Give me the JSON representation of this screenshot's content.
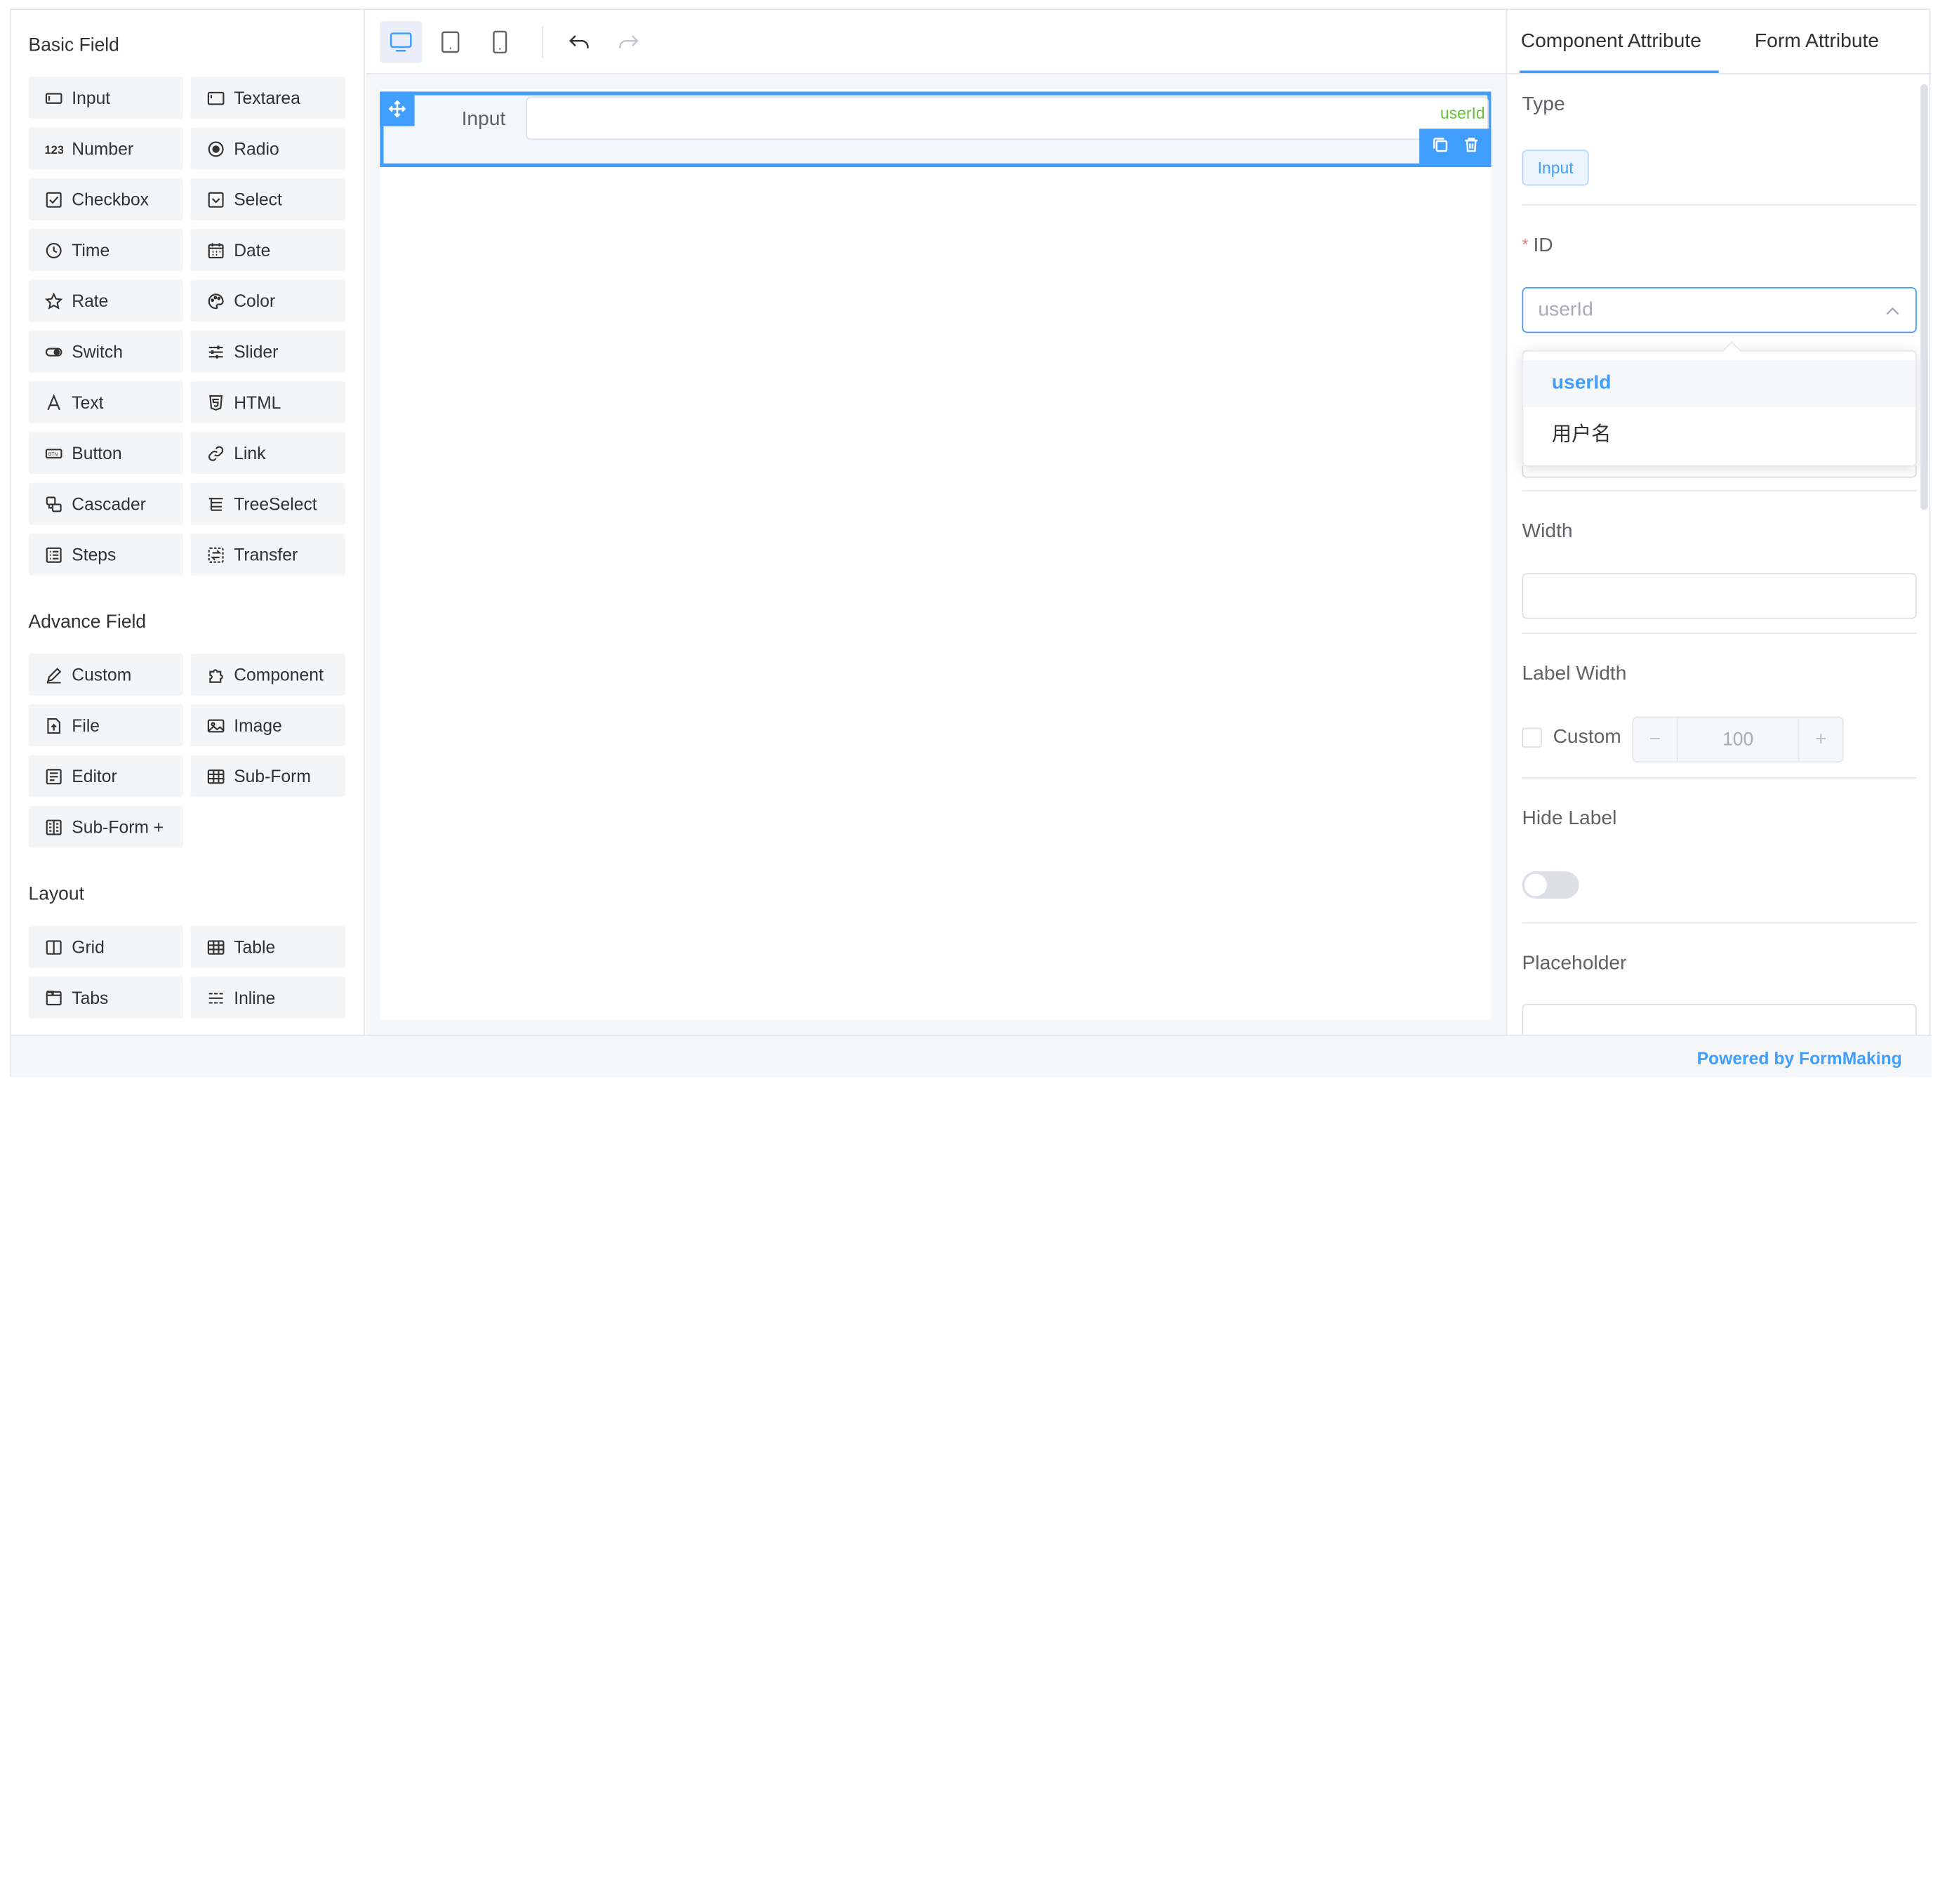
{
  "left_panel": {
    "sections": [
      {
        "title": "Basic Field",
        "items": [
          {
            "label": "Input",
            "icon": "input-icon"
          },
          {
            "label": "Textarea",
            "icon": "textarea-icon"
          },
          {
            "label": "Number",
            "icon": "number-icon"
          },
          {
            "label": "Radio",
            "icon": "radio-icon"
          },
          {
            "label": "Checkbox",
            "icon": "checkbox-icon"
          },
          {
            "label": "Select",
            "icon": "select-icon"
          },
          {
            "label": "Time",
            "icon": "clock-icon"
          },
          {
            "label": "Date",
            "icon": "calendar-icon"
          },
          {
            "label": "Rate",
            "icon": "star-icon"
          },
          {
            "label": "Color",
            "icon": "palette-icon"
          },
          {
            "label": "Switch",
            "icon": "switch-icon"
          },
          {
            "label": "Slider",
            "icon": "slider-icon"
          },
          {
            "label": "Text",
            "icon": "text-icon"
          },
          {
            "label": "HTML",
            "icon": "html-icon"
          },
          {
            "label": "Button",
            "icon": "button-icon"
          },
          {
            "label": "Link",
            "icon": "link-icon"
          },
          {
            "label": "Cascader",
            "icon": "cascader-icon"
          },
          {
            "label": "TreeSelect",
            "icon": "tree-icon"
          },
          {
            "label": "Steps",
            "icon": "steps-icon"
          },
          {
            "label": "Transfer",
            "icon": "transfer-icon"
          }
        ]
      },
      {
        "title": "Advance Field",
        "items": [
          {
            "label": "Custom",
            "icon": "pen-icon"
          },
          {
            "label": "Component",
            "icon": "puzzle-icon"
          },
          {
            "label": "File",
            "icon": "file-upload-icon"
          },
          {
            "label": "Image",
            "icon": "image-icon"
          },
          {
            "label": "Editor",
            "icon": "editor-icon"
          },
          {
            "label": "Sub-Form",
            "icon": "table-icon"
          },
          {
            "label": "Sub-Form +",
            "icon": "subform-plus-icon"
          }
        ]
      },
      {
        "title": "Layout",
        "items": [
          {
            "label": "Grid",
            "icon": "grid-icon"
          },
          {
            "label": "Table",
            "icon": "table-icon"
          },
          {
            "label": "Tabs",
            "icon": "tabs-icon"
          },
          {
            "label": "Inline",
            "icon": "inline-icon"
          }
        ]
      }
    ]
  },
  "toolbar": {
    "buttons": [
      "desktop-icon",
      "tablet-icon",
      "mobile-icon",
      "undo-icon",
      "redo-icon"
    ],
    "active": "desktop-icon"
  },
  "canvas": {
    "field": {
      "label": "Input",
      "model": "userId"
    }
  },
  "right_panel": {
    "tabs": [
      "Component Attribute",
      "Form Attribute"
    ],
    "active_tab": "Component Attribute",
    "type_label": "Type",
    "type_value": "Input",
    "id_required_mark": "*",
    "id_label": "ID",
    "id_value": "userId",
    "id_options": [
      "userId",
      "用户名"
    ],
    "id_selected": "userId",
    "width_label": "Width",
    "width_value": "",
    "label_width_label": "Label Width",
    "label_width_custom": "Custom",
    "label_width_custom_checked": false,
    "label_width_value": "100",
    "stepper_minus": "−",
    "stepper_plus": "+",
    "hide_label_label": "Hide Label",
    "hide_label_on": false,
    "placeholder_label": "Placeholder"
  },
  "footer": {
    "powered": "Powered by FormMaking"
  },
  "colors": {
    "accent": "#409eff",
    "model_tag": "#67c23a",
    "required": "#f56c6c"
  }
}
